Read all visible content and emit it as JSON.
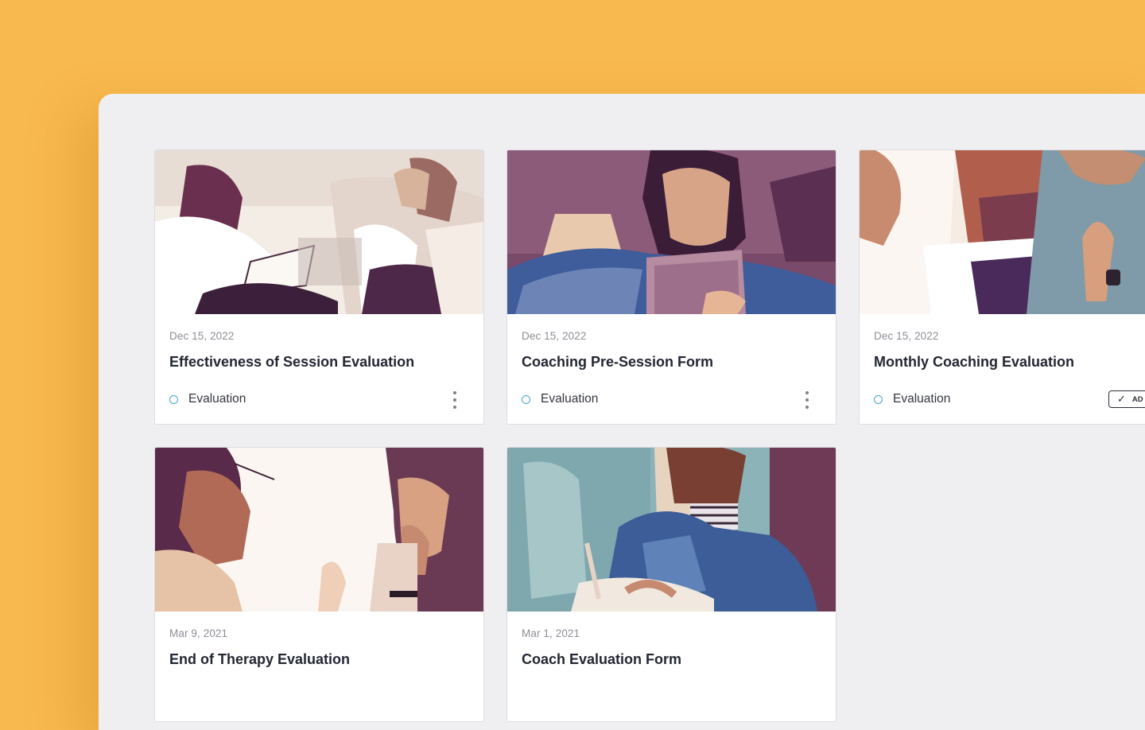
{
  "cards": [
    {
      "date": "Dec 15, 2022",
      "title": "Effectiveness of Session Evaluation",
      "tag": "Evaluation",
      "image_icon": "photo-two-people-coaching"
    },
    {
      "date": "Dec 15, 2022",
      "title": "Coaching Pre-Session Form",
      "tag": "Evaluation",
      "image_icon": "photo-woman-with-tablet"
    },
    {
      "date": "Dec 15, 2022",
      "title": "Monthly Coaching Evaluation",
      "tag": "Evaluation",
      "added_label": "AD",
      "image_icon": "photo-smiling-man"
    },
    {
      "date": "Mar 9, 2021",
      "title": "End of Therapy Evaluation",
      "image_icon": "photo-woman-listening"
    },
    {
      "date": "Mar 1, 2021",
      "title": "Coach Evaluation Form",
      "image_icon": "photo-woman-writing"
    }
  ],
  "colors": {
    "background": "#f8b94e",
    "panel": "#efeff1",
    "tag_dot": "#45a7c9",
    "title": "#232733"
  }
}
